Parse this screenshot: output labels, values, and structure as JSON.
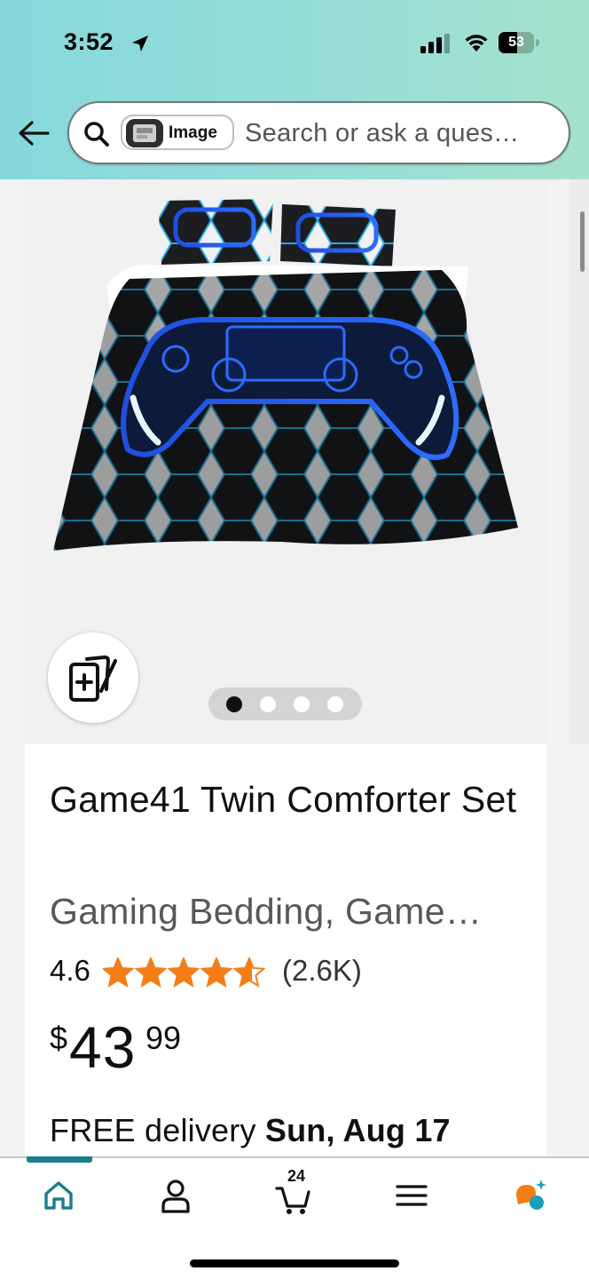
{
  "status_bar": {
    "time": "3:52",
    "battery_level": "53",
    "battery_fraction": 0.53
  },
  "header": {
    "search_chip_label": "Image",
    "search_placeholder": "Search or ask a ques…"
  },
  "gallery": {
    "image_count": 4,
    "active_index": 0
  },
  "product": {
    "title": "Game41 Twin Comforter Set",
    "subtitle": "Gaming Bedding, Game…",
    "rating": "4.6",
    "rating_stars": 4.6,
    "rating_count": "(2.6K)",
    "price_symbol": "$",
    "price_whole": "43",
    "price_fraction": "99",
    "delivery_prefix": "FREE delivery ",
    "delivery_date": "Sun, Aug 17"
  },
  "bottom_nav": {
    "items": [
      "home-icon",
      "account-icon",
      "cart-icon",
      "menu-icon",
      "rufus-icon"
    ],
    "cart_count": "24",
    "active": "home"
  },
  "colors": {
    "header_gradient_start": "#86d8dc",
    "header_gradient_end": "#a5e2cd",
    "star_color": "#f47e16",
    "active_nav": "#1b7d8e",
    "rufus_orange": "#f47e16",
    "rufus_teal": "#1b9fb8"
  }
}
